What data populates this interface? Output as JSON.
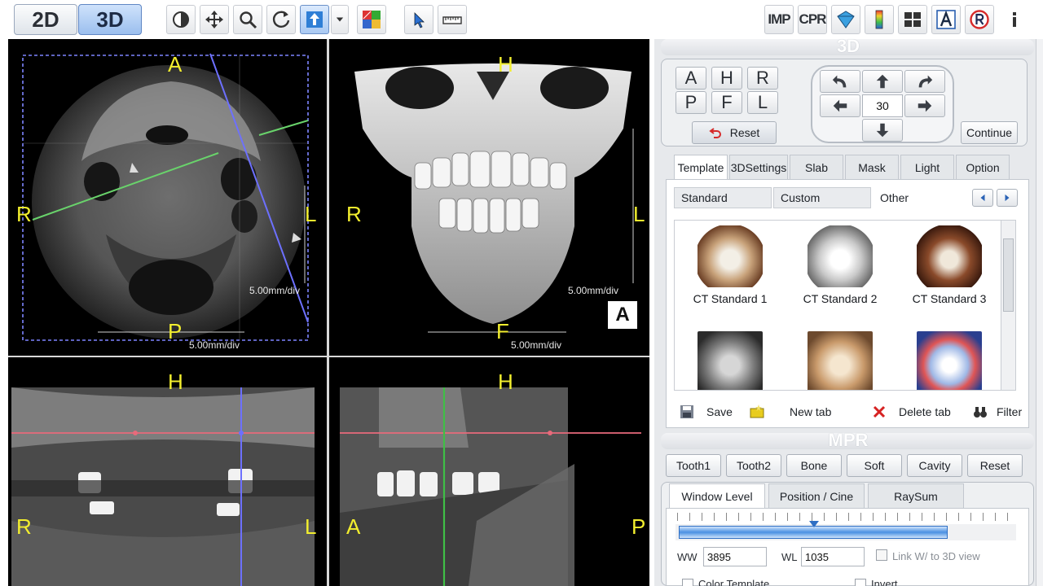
{
  "toolbar": {
    "mode_2d": "2D",
    "mode_3d": "3D",
    "imp": "IMP",
    "cpr": "CPR"
  },
  "viewports": {
    "axial": {
      "top": "A",
      "left": "R",
      "right": "L",
      "bottom": "P",
      "scale_side": "5.00mm/div",
      "scale_bottom": "5.00mm/div"
    },
    "volume": {
      "top": "H",
      "left": "R",
      "right": "L",
      "bottom": "F",
      "scale_side": "5.00mm/div",
      "scale_bottom": "5.00mm/div",
      "orient_badge": "A"
    },
    "coronal": {
      "top": "H",
      "left": "R",
      "right": "L"
    },
    "sagittal": {
      "top": "H",
      "left": "A",
      "right": "P"
    }
  },
  "panel3d": {
    "title": "3D",
    "orient_keys": [
      "A",
      "H",
      "R",
      "P",
      "F",
      "L"
    ],
    "rotate_step": "30",
    "reset": "Reset",
    "continue": "Continue",
    "tabs": [
      "Template",
      "3DSettings",
      "Slab",
      "Mask",
      "Light",
      "Option"
    ],
    "subtabs": [
      "Standard",
      "Custom",
      "Other"
    ],
    "templates": [
      "CT Standard 1",
      "CT Standard 2",
      "CT Standard 3"
    ],
    "footer": {
      "save": "Save",
      "new_tab": "New tab",
      "delete_tab": "Delete tab",
      "filter": "Filter"
    }
  },
  "mpr": {
    "title": "MPR",
    "presets": [
      "Tooth1",
      "Tooth2",
      "Bone",
      "Soft",
      "Cavity",
      "Reset"
    ],
    "tabs": [
      "Window Level",
      "Position / Cine",
      "RaySum"
    ],
    "ww_label": "WW",
    "ww_value": "3895",
    "wl_label": "WL",
    "wl_value": "1035",
    "link_label": "Link W/ to 3D view",
    "color_template": "Color Template",
    "invert": "Invert"
  }
}
